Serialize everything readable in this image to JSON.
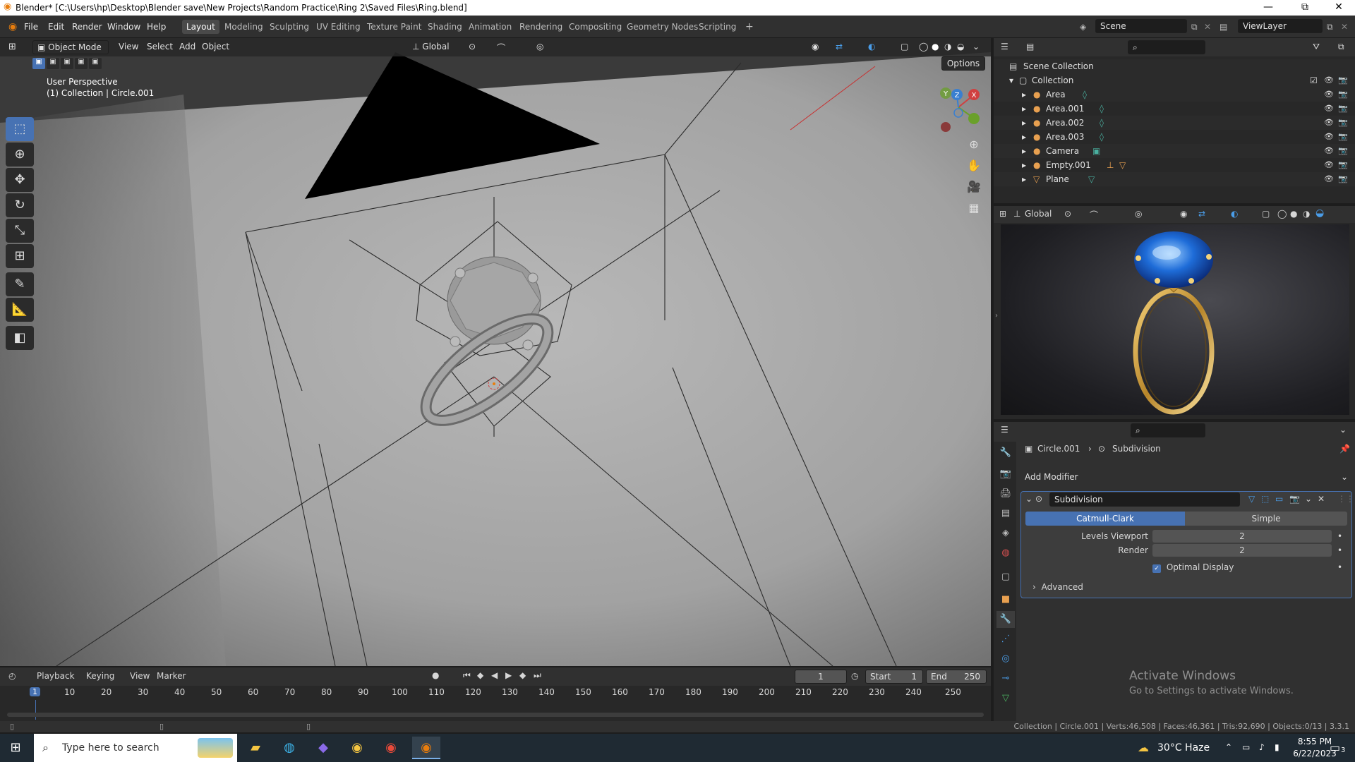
{
  "title_bar": {
    "title": "Blender* [C:\\Users\\hp\\Desktop\\Blender save\\New Projects\\Random Practice\\Ring 2\\Saved Files\\Ring.blend]",
    "minimize": "—",
    "maximize": "⧉",
    "close": "✕"
  },
  "menu": {
    "items": [
      "File",
      "Edit",
      "Render",
      "Window",
      "Help"
    ]
  },
  "workspaces": {
    "tabs": [
      "Layout",
      "Modeling",
      "Sculpting",
      "UV Editing",
      "Texture Paint",
      "Shading",
      "Animation",
      "Rendering",
      "Compositing",
      "Geometry Nodes",
      "Scripting"
    ],
    "active": "Layout",
    "add": "+"
  },
  "scene": {
    "label": "Scene",
    "view_layer": "ViewLayer"
  },
  "viewport": {
    "mode": "Object Mode",
    "menus": [
      "View",
      "Select",
      "Add",
      "Object"
    ],
    "orientation": "Global",
    "options": "Options",
    "perspective": "User Perspective",
    "collection_info": "(1) Collection | Circle.001",
    "gizmo_axes": [
      "X",
      "Y",
      "Z"
    ]
  },
  "outliner": {
    "root": "Scene Collection",
    "collection": "Collection",
    "items": [
      "Area",
      "Area.001",
      "Area.002",
      "Area.003",
      "Camera",
      "Empty.001",
      "Plane"
    ]
  },
  "preview": {
    "orientation": "Global"
  },
  "properties": {
    "breadcrumb_object": "Circle.001",
    "breadcrumb_modifier": "Subdivision",
    "add_modifier": "Add Modifier",
    "modifier_name": "Subdivision",
    "catmull_clark": "Catmull-Clark",
    "simple": "Simple",
    "levels_viewport_label": "Levels Viewport",
    "levels_viewport_value": "2",
    "render_label": "Render",
    "render_value": "2",
    "optimal_display": "Optimal Display",
    "advanced": "Advanced"
  },
  "timeline": {
    "menus": [
      "Playback",
      "Keying",
      "View",
      "Marker"
    ],
    "current_frame": "1",
    "start_label": "Start",
    "start_value": "1",
    "end_label": "End",
    "end_value": "250",
    "ruler": [
      "1",
      "10",
      "20",
      "30",
      "40",
      "50",
      "60",
      "70",
      "80",
      "90",
      "100",
      "110",
      "120",
      "130",
      "140",
      "150",
      "160",
      "170",
      "180",
      "190",
      "200",
      "210",
      "220",
      "230",
      "240",
      "250"
    ]
  },
  "watermark": {
    "line1": "Activate Windows",
    "line2": "Go to Settings to activate Windows."
  },
  "status_bar": {
    "stats": "Collection | Circle.001 | Verts:46,508 | Faces:46,361 | Tris:92,690 | Objects:0/13 | 3.3.1"
  },
  "taskbar": {
    "search_placeholder": "Type here to search",
    "weather": "30°C  Haze",
    "time": "8:55 PM",
    "date": "6/22/2023",
    "notif_count": "3"
  }
}
